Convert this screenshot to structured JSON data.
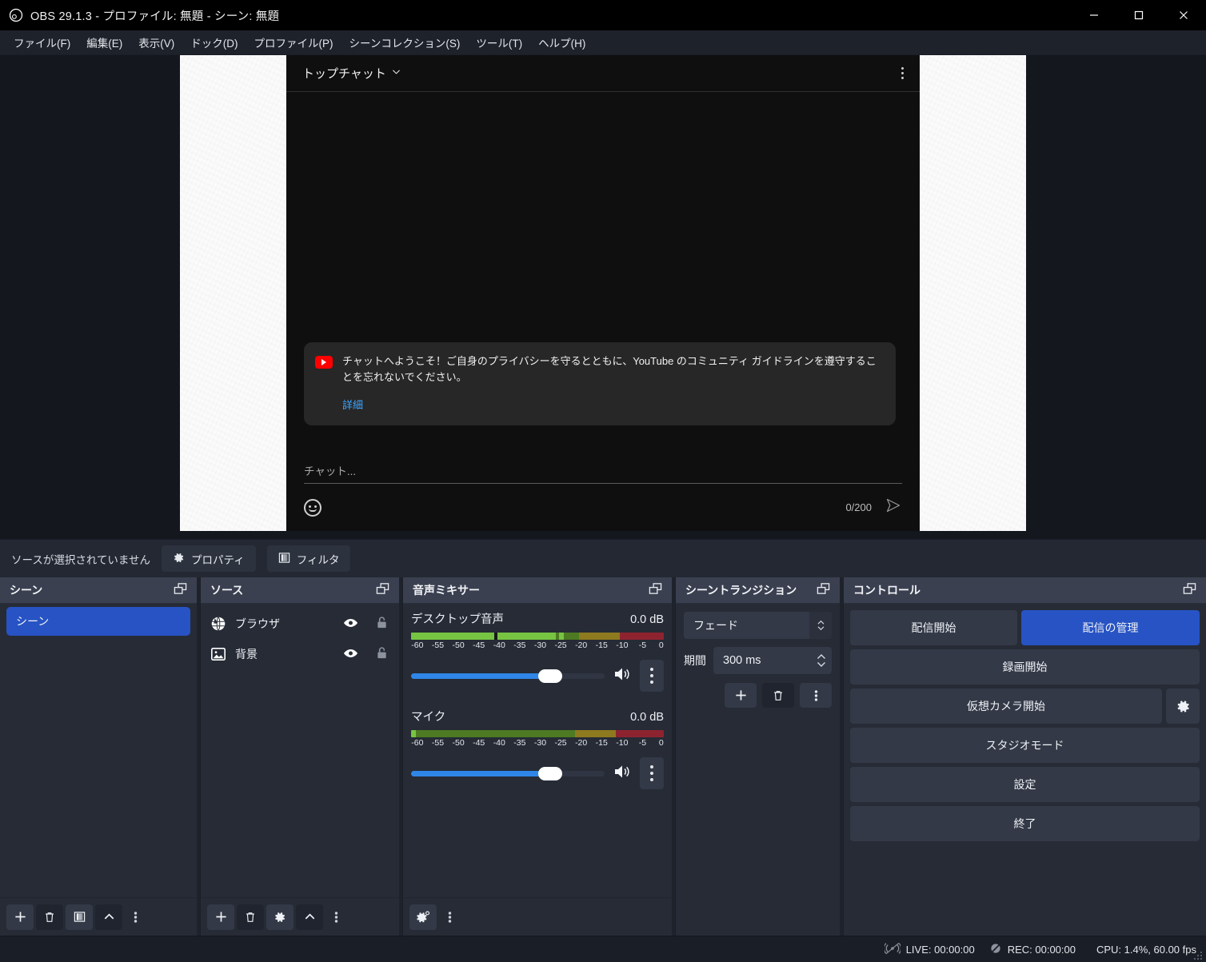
{
  "window": {
    "title": "OBS 29.1.3 - プロファイル: 無題 - シーン: 無題",
    "app_icon": "obs-logo-icon",
    "minimize_label": "−",
    "maximize_label": "□",
    "close_label": "✕"
  },
  "menubar": {
    "items": [
      {
        "label": "ファイル(F)",
        "name": "menu-file"
      },
      {
        "label": "編集(E)",
        "name": "menu-edit"
      },
      {
        "label": "表示(V)",
        "name": "menu-view"
      },
      {
        "label": "ドック(D)",
        "name": "menu-dock"
      },
      {
        "label": "プロファイル(P)",
        "name": "menu-profile"
      },
      {
        "label": "シーンコレクション(S)",
        "name": "menu-scene-collection"
      },
      {
        "label": "ツール(T)",
        "name": "menu-tools"
      },
      {
        "label": "ヘルプ(H)",
        "name": "menu-help"
      }
    ]
  },
  "preview": {
    "chat": {
      "header_title": "トップチャット",
      "header_chevron": "chevron-down-icon",
      "kebab": "more-options-icon",
      "notice_text": "チャットへようこそ！ご自身のプライバシーを守るとともに、YouTube のコミュニティ ガイドラインを遵守することを忘れないでください。",
      "notice_link": "詳細",
      "input_placeholder": "チャット...",
      "char_counter": "0/200",
      "emoji_icon": "emoji-icon",
      "send_icon": "send-icon"
    }
  },
  "source_toolbar": {
    "note": "ソースが選択されていません",
    "properties_label": "プロパティ",
    "filters_label": "フィルタ"
  },
  "scenes_dock": {
    "title": "シーン",
    "float_icon": "undock-icon",
    "items": [
      {
        "label": "シーン",
        "selected": true
      }
    ],
    "footer": [
      "add-icon",
      "remove-icon",
      "filters-icon",
      "move-up-icon",
      "more-icon"
    ]
  },
  "sources_dock": {
    "title": "ソース",
    "float_icon": "undock-icon",
    "items": [
      {
        "label": "ブラウザ",
        "icon": "browser-globe-icon",
        "visible": true,
        "locked": false
      },
      {
        "label": "背景",
        "icon": "image-icon",
        "visible": true,
        "locked": false
      }
    ],
    "footer": [
      "add-icon",
      "remove-icon",
      "properties-gear-icon",
      "move-up-icon",
      "more-icon"
    ]
  },
  "mixer_dock": {
    "title": "音声ミキサー",
    "float_icon": "undock-icon",
    "tick_labels": [
      "-60",
      "-55",
      "-50",
      "-45",
      "-40",
      "-35",
      "-30",
      "-25",
      "-20",
      "-15",
      "-10",
      "-5",
      "0"
    ],
    "channels": [
      {
        "name": "デスクトップ音声",
        "db": "0.0 dB",
        "level_percent": 77,
        "peak_percent": 57,
        "volume_percent": 69,
        "mute_icon": "speaker-on-icon",
        "kebab": "more-options-icon"
      },
      {
        "name": "マイク",
        "db": "0.0 dB",
        "level_percent": 0,
        "peak_percent": 0,
        "volume_percent": 69,
        "mute_icon": "speaker-on-icon",
        "kebab": "more-options-icon"
      }
    ],
    "footer": [
      "audio-settings-icon",
      "more-icon"
    ]
  },
  "transitions_dock": {
    "title": "シーントランジション",
    "float_icon": "undock-icon",
    "transition_value": "フェード",
    "duration_label": "期間",
    "duration_value": "300 ms",
    "buttons": [
      "add-icon",
      "remove-icon",
      "more-icon"
    ]
  },
  "controls_dock": {
    "title": "コントロール",
    "float_icon": "undock-icon",
    "start_stream_label": "配信開始",
    "manage_stream_label": "配信の管理",
    "start_record_label": "録画開始",
    "start_virtual_cam_label": "仮想カメラ開始",
    "virtual_cam_settings_icon": "gear-icon",
    "studio_mode_label": "スタジオモード",
    "settings_label": "設定",
    "exit_label": "終了"
  },
  "statusbar": {
    "live_icon": "stream-inactive-icon",
    "live_text": "LIVE: 00:00:00",
    "rec_icon": "record-inactive-icon",
    "rec_text": "REC: 00:00:00",
    "cpu_text": "CPU: 1.4%, 60.00 fps"
  },
  "colors": {
    "accent_blue": "#2753c4",
    "slider_blue": "#2f86e8",
    "panel_bg": "#262b36",
    "header_bg": "#3a4050",
    "titlebar_bg": "#000000",
    "meter_green": "#76c442",
    "meter_green_dark": "#4d7a22",
    "meter_yellow": "#8e7a1f",
    "meter_red": "#8e2330",
    "link_blue": "#3ea6ff",
    "youtube_red": "#ff0000"
  }
}
